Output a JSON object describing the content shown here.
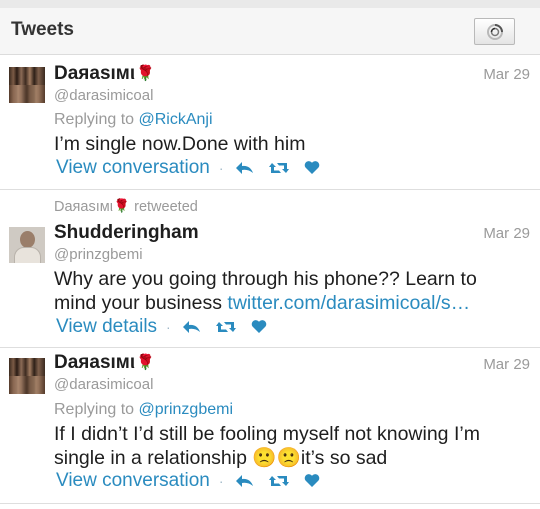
{
  "header": {
    "title": "Tweets",
    "refresh_icon": "loading-spinner-icon"
  },
  "colors": {
    "link": "#2a8bbf",
    "muted": "#9a9a9a",
    "rose_emoji": "#d2461c"
  },
  "tweets": [
    {
      "name": "Daяasıмι",
      "name_emoji": "rose-emoji",
      "handle": "@darasimicoal",
      "date": "Mar 29",
      "reply_prefix": "Replying to",
      "reply_to": "@RickAnji",
      "text": "I’m single now.Done with him",
      "action_label": "View conversation",
      "action_separator": "·",
      "icons": [
        "reply-icon",
        "retweet-icon",
        "like-icon"
      ]
    },
    {
      "retweet_by": "Daяasıмι",
      "retweet_suffix": "retweeted",
      "name": "Shudderingham",
      "handle": "@prinzgbemi",
      "date": "Mar 29",
      "text": "Why are you going through his phone?? Learn to mind your business",
      "link": "twitter.com/darasimicoal/s…",
      "action_label": "View details",
      "action_separator": "·",
      "icons": [
        "reply-icon",
        "retweet-icon",
        "like-icon"
      ]
    },
    {
      "name": "Daяasıмι",
      "name_emoji": "rose-emoji",
      "handle": "@darasimicoal",
      "date": "Mar 29",
      "reply_prefix": "Replying to",
      "reply_to": "@prinzgbemi",
      "text": "If I didn’t I’d still be fooling myself not knowing I’m single in a relationship 🙁🙁it’s so sad",
      "action_label": "View conversation",
      "action_separator": "·",
      "icons": [
        "reply-icon",
        "retweet-icon",
        "like-icon"
      ]
    }
  ]
}
